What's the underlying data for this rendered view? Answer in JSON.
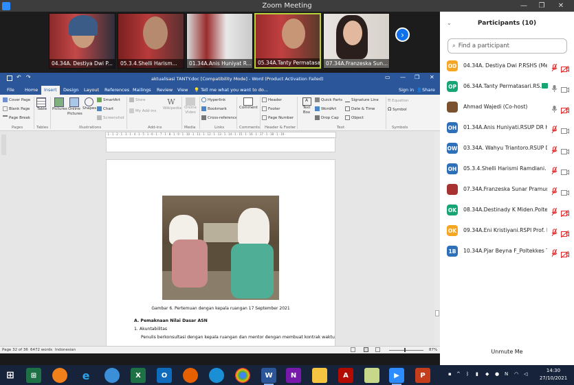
{
  "zoom": {
    "title": "Zoom Meeting"
  },
  "gallery": {
    "tiles": [
      "04.34A. Destiya Dwi P...",
      "05.3.4.Shelli Harism...",
      "01.34A.Anis Huniyat R...",
      "05.34A.Tanty Permatasari...",
      "07.34A.Franzeska Sun..."
    ],
    "next_icon": "›"
  },
  "word": {
    "title": "aktualisasi TANTY.doc [Compatibility Mode] - Word (Product Activation Failed)",
    "tabs": [
      "File",
      "Home",
      "Insert",
      "Design",
      "Layout",
      "References",
      "Mailings",
      "Review",
      "View"
    ],
    "tell_me": "Tell me what you want to do...",
    "sign_in": "Sign in",
    "share": "Share",
    "ribbon": {
      "pages": [
        "Cover Page",
        "Blank Page",
        "Page Break"
      ],
      "groups": [
        "Pages",
        "Tables",
        "Illustrations",
        "Add-ins",
        "Media",
        "Links",
        "Comments",
        "Header & Footer",
        "Text",
        "Symbols"
      ],
      "table": "Table",
      "pictures": "Pictures",
      "online_pictures": "Online Pictures",
      "shapes": "Shapes",
      "smartart": "SmartArt",
      "chart": "Chart",
      "screenshot": "Screenshot",
      "store": "Store",
      "my_addins": "My Add-ins",
      "wikipedia": "Wikipedia",
      "online_video": "Online Video",
      "hyperlink": "Hyperlink",
      "bookmark": "Bookmark",
      "cross_reference": "Cross-reference",
      "comment": "Comment",
      "header": "Header",
      "footer": "Footer",
      "page_number": "Page Number",
      "text_box": "Text Box",
      "quick_parts": "Quick Parts",
      "wordart": "WordArt",
      "drop_cap": "Drop Cap",
      "signature_line": "Signature Line",
      "date_time": "Date & Time",
      "object": "Object",
      "equation": "Equation",
      "symbol": "Symbol"
    },
    "doc": {
      "caption": "Gambar 6. Pertemuan dengan kepala ruangan 17 September 2021",
      "heading": "A.  Pemaknaan Nilai Dasar ASN",
      "item": "1.   Akuntabilitas",
      "line": "Penulis berkonsultasi dengan kepala ruangan dan mentor dengan membuat kontrak waktu"
    },
    "status": {
      "page": "Page 32 of 36",
      "words": "6472 words",
      "lang": "Indonesian",
      "zoom": "87%"
    }
  },
  "participants": {
    "header": "Participants (10)",
    "search_placeholder": "Find a participant",
    "list": [
      {
        "initials": "OD",
        "name": "04.34A. Destiya Dwi P.RSHS (Me)",
        "color": "#f5a623",
        "mic": "muted",
        "cam": "off"
      },
      {
        "initials": "OP",
        "name": "06.34A.Tanty Permatasari.RS...",
        "color": "#17a673",
        "mic": "on",
        "cam": "on"
      },
      {
        "initials": "",
        "name": "Ahmad Wajedi (Co-host)",
        "color": "#7a5230",
        "mic": "on",
        "cam": "off"
      },
      {
        "initials": "OH",
        "name": "01.34A.Anis Huniyati.RSUP DR Ha...",
        "color": "#2d6fb8",
        "mic": "muted",
        "cam": "on"
      },
      {
        "initials": "OW",
        "name": "03.34A. Wahyu Triantoro.RSUP D...",
        "color": "#2d6fb8",
        "mic": "muted",
        "cam": "on"
      },
      {
        "initials": "OH",
        "name": "05.3.4.Shelli Harismi Ramdiani. R...",
        "color": "#2d6fb8",
        "mic": "muted",
        "cam": "on"
      },
      {
        "initials": "",
        "name": "07.34A.Franzeska Sunar Pramudit...",
        "color": "#a83232",
        "mic": "muted",
        "cam": "on"
      },
      {
        "initials": "OK",
        "name": "08.34A.Destinady K Miden.Poltek...",
        "color": "#17a673",
        "mic": "muted",
        "cam": "off"
      },
      {
        "initials": "OK",
        "name": "09.34A.Eni Kristiyani.RSPI Prof. Dr...",
        "color": "#f5a623",
        "mic": "muted",
        "cam": "off"
      },
      {
        "initials": "1B",
        "name": "10.34A.Pjar Beyna F_Poltekkes Ta...",
        "color": "#2d6fb8",
        "mic": "muted",
        "cam": "off"
      }
    ],
    "unmute": "Unmute Me"
  },
  "taskbar": {
    "time": "14:30",
    "date": "27/10/2021"
  }
}
